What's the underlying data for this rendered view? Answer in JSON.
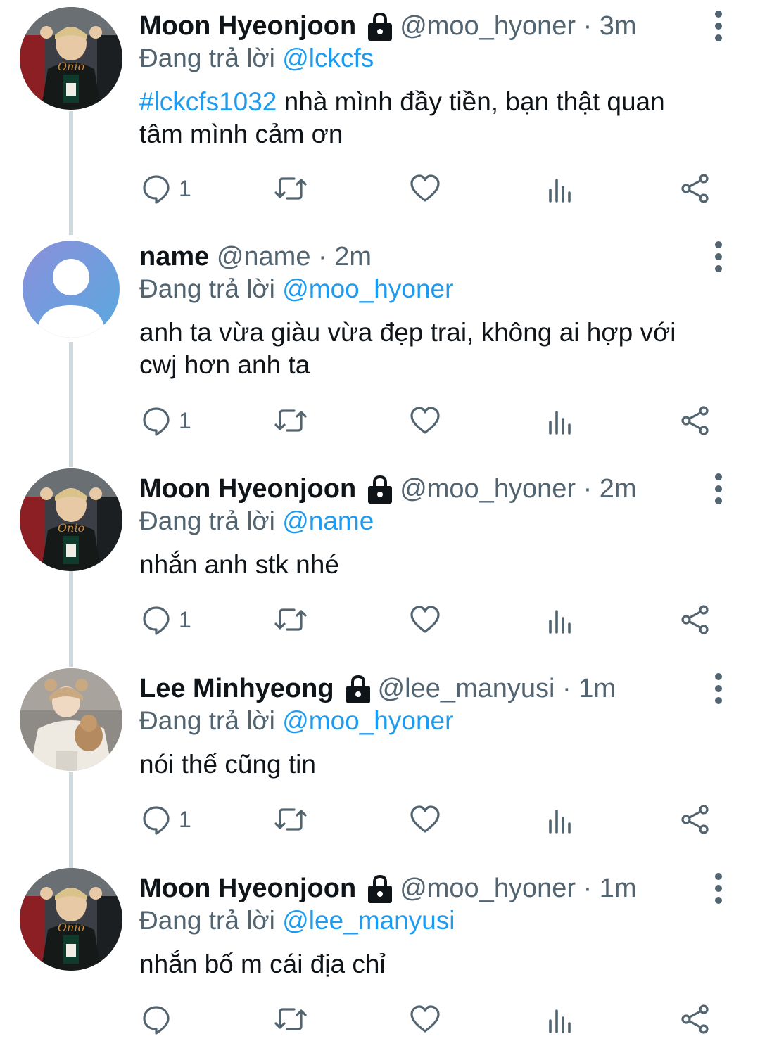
{
  "tweets": [
    {
      "name": "Moon Hyeonjoon",
      "handle": "@moo_hyoner",
      "time": "3m",
      "meta": "@moo_hyoner · 3m",
      "replying_prefix": "Đang trả lời ",
      "replying_to": "@lckcfs",
      "hashtag": "#lckcfs1032",
      "body": " nhà mình đầy tiền, bạn thật quan tâm mình cảm ơn",
      "reply_count": "1",
      "locked": true,
      "avatar": "player-photo"
    },
    {
      "name": "name",
      "handle": "@name",
      "time": "2m",
      "meta": "@name · 2m",
      "replying_prefix": "Đang trả lời ",
      "replying_to": "@moo_hyoner",
      "body": "anh ta vừa giàu vừa đẹp trai, không ai hợp với cwj hơn anh ta",
      "reply_count": "1",
      "locked": false,
      "avatar": "default-user"
    },
    {
      "name": "Moon Hyeonjoon",
      "handle": "@moo_hyoner",
      "time": "2m",
      "meta": "@moo_hyoner · 2m",
      "replying_prefix": "Đang trả lời ",
      "replying_to": "@name",
      "body": "nhắn anh stk nhé",
      "reply_count": "1",
      "locked": true,
      "avatar": "player-photo"
    },
    {
      "name": "Lee Minhyeong",
      "handle": "@lee_manyusi",
      "time": "1m",
      "meta": "@lee_manyusi · 1m",
      "replying_prefix": "Đang trả lời ",
      "replying_to": "@moo_hyoner",
      "body": "nói thế cũng tin",
      "reply_count": "1",
      "locked": true,
      "avatar": "bear-hat-photo"
    },
    {
      "name": "Moon Hyeonjoon",
      "handle": "@moo_hyoner",
      "time": "1m",
      "meta": "@moo_hyoner · 1m",
      "replying_prefix": "Đang trả lời ",
      "replying_to": "@lee_manyusi",
      "body": "nhắn bố m cái địa chỉ",
      "reply_count": "",
      "locked": true,
      "avatar": "player-photo"
    }
  ],
  "colors": {
    "text": "#0f1419",
    "secondary": "#536471",
    "link": "#1d9bf0",
    "thread_line": "#cfd9de"
  },
  "icons": {
    "reply": "reply-icon",
    "retweet": "retweet-icon",
    "like": "heart-icon",
    "stats": "views-chart-icon",
    "share": "share-icon",
    "lock": "lock-icon",
    "more": "more-vertical-icon"
  }
}
